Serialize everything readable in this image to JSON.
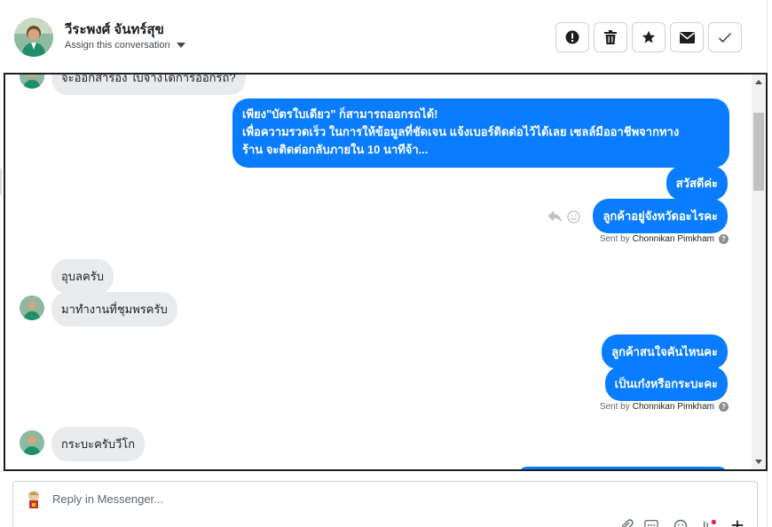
{
  "header": {
    "contact_name": "วีระพงศ์ จันทร์สุข",
    "assign_label": "Assign this conversation"
  },
  "actions": [
    {
      "icon": "alert-icon"
    },
    {
      "icon": "trash-icon"
    },
    {
      "icon": "star-icon"
    },
    {
      "icon": "envelope-icon"
    },
    {
      "icon": "check-icon"
    }
  ],
  "messages": {
    "m0": "จะออกสารอง ใบจางไดการออกรถ?",
    "m1_line1": "เพียง\"บัตรใบเดียว\" ก็สามารถออกรถได้!",
    "m1_line2": "เพื่อความรวดเร็ว ในการให้ข้อมูลที่ชัดเจน แจ้งเบอร์ติดต่อไว้ได้เลย เซลล์มืออาชีพจากทาง",
    "m1_line3": "ร้าน จะติดต่อกลับภายใน 10 นาทีจ้า...",
    "m2": "สวัสดีค่ะ",
    "m3": "ลูกค้าอยู่จังหวัดอะไรคะ",
    "sent_by_1_prefix": "Sent by",
    "sent_by_1_name": "Chonnikan Pimkham",
    "m4": "อุบลครับ",
    "m5": "มาทำงานที่ชุมพรครับ",
    "m6": "ลูกค้าสนใจคันไหนคะ",
    "m7": "เป็นเก๋งหรือกระบะคะ",
    "sent_by_2_prefix": "Sent by",
    "sent_by_2_name": "Chonnikan Pimkham",
    "m8": "กระบะครับวีโก"
  },
  "reply": {
    "placeholder": "Reply in Messenger..."
  },
  "colors": {
    "outgoing_bubble": "#0a7cff",
    "incoming_bubble": "#e9eaec"
  }
}
